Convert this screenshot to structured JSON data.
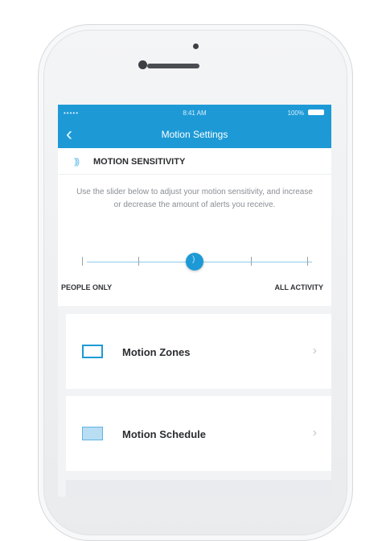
{
  "status_bar": {
    "signal": "•••••",
    "time": "8:41 AM",
    "battery_percent": "100%"
  },
  "nav": {
    "back_icon": "chevron-left-icon",
    "title": "Motion Settings"
  },
  "sensitivity": {
    "icon": "motion-waves-icon",
    "title": "MOTION SENSITIVITY",
    "description": "Use the slider below to adjust your motion sensitivity, and increase or decrease the amount of alerts you receive.",
    "slider": {
      "min_label": "PEOPLE ONLY",
      "max_label": "ALL ACTIVITY",
      "steps": 5,
      "selected_step": 3
    }
  },
  "menu": [
    {
      "label": "Motion Zones",
      "icon": "zones-frame-icon"
    },
    {
      "label": "Motion Schedule",
      "icon": "schedule-icon"
    }
  ],
  "colors": {
    "accent": "#1d9ad6",
    "background": "#f2f3f5"
  }
}
